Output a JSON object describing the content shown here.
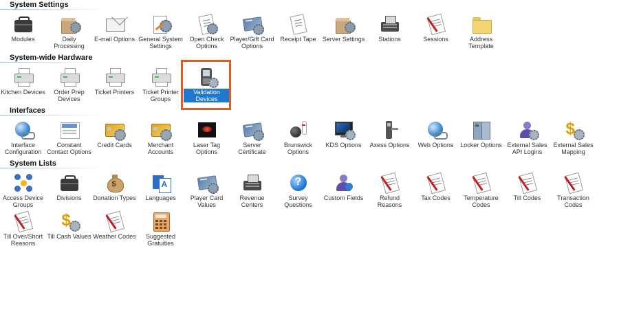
{
  "colors": {
    "selection_border": "#e55a20",
    "selection_bg": "#1e78d0",
    "header_rule": "#8ab4d6"
  },
  "sections": [
    {
      "title": "System Settings",
      "items": [
        {
          "label": "Modules",
          "icon": "briefcase-icon"
        },
        {
          "label": "Daily Processing",
          "icon": "gear-box-icon"
        },
        {
          "label": "E-mail Options",
          "icon": "envelope-icon"
        },
        {
          "label": "General System Settings",
          "icon": "gear-sheet-icon"
        },
        {
          "label": "Open Check Options",
          "icon": "check-gear-icon"
        },
        {
          "label": "Player/Gift Card Options",
          "icon": "gift-card-icon"
        },
        {
          "label": "Receipt Tape",
          "icon": "receipt-icon"
        },
        {
          "label": "Server Settings",
          "icon": "server-box-icon"
        },
        {
          "label": "Stations",
          "icon": "register-icon"
        },
        {
          "label": "Sessions",
          "icon": "checklist-icon"
        },
        {
          "label": "Address Template",
          "icon": "folder-icon"
        }
      ]
    },
    {
      "title": "System-wide Hardware",
      "items": [
        {
          "label": "Kitchen Devices",
          "icon": "printer-icon"
        },
        {
          "label": "Order Prep Devices",
          "icon": "printer-icon"
        },
        {
          "label": "Ticket Printers",
          "icon": "printer-icon"
        },
        {
          "label": "Ticket Printer Groups",
          "icon": "printer-icon"
        },
        {
          "label": "Validation Devices",
          "icon": "handheld-device-icon",
          "selected": true
        }
      ]
    },
    {
      "title": "Interfaces",
      "items": [
        {
          "label": "Interface Configuration",
          "icon": "globe-link-icon"
        },
        {
          "label": "Constant Contact Options",
          "icon": "constant-contact-icon"
        },
        {
          "label": "Credit Cards",
          "icon": "credit-card-icon"
        },
        {
          "label": "Merchant Accounts",
          "icon": "credit-card-icon"
        },
        {
          "label": "Laser Tag Options",
          "icon": "laser-tag-icon"
        },
        {
          "label": "Server Certificate",
          "icon": "certificate-card-icon"
        },
        {
          "label": "Brunswick Options",
          "icon": "bowling-icon"
        },
        {
          "label": "KDS Options",
          "icon": "monitor-icon"
        },
        {
          "label": "Axess Options",
          "icon": "turnstile-icon"
        },
        {
          "label": "Web Options",
          "icon": "globe-link-icon"
        },
        {
          "label": "Locker Options",
          "icon": "locker-icon"
        },
        {
          "label": "External Sales API Logins",
          "icon": "user-icon"
        },
        {
          "label": "External Sales Mapping",
          "icon": "dollar-gear-icon"
        }
      ]
    },
    {
      "title": "System Lists",
      "items": [
        {
          "label": "Access Device Groups",
          "icon": "network-icon"
        },
        {
          "label": "Divisions",
          "icon": "briefcase-icon"
        },
        {
          "label": "Donation Types",
          "icon": "money-bag-icon"
        },
        {
          "label": "Languages",
          "icon": "languages-icon"
        },
        {
          "label": "Player Card Values",
          "icon": "gift-card-icon"
        },
        {
          "label": "Revenue Centers",
          "icon": "register-icon"
        },
        {
          "label": "Survey Questions",
          "icon": "help-icon"
        },
        {
          "label": "Custom Fields",
          "icon": "user-help-icon"
        },
        {
          "label": "Refund Reasons",
          "icon": "checklist-icon"
        },
        {
          "label": "Tax Codes",
          "icon": "checklist-icon"
        },
        {
          "label": "Temperature Codes",
          "icon": "checklist-icon"
        },
        {
          "label": "Till Codes",
          "icon": "checklist-icon"
        },
        {
          "label": "Transaction Codes",
          "icon": "checklist-icon"
        },
        {
          "label": "Till Over/Short Reasons",
          "icon": "checklist-icon"
        },
        {
          "label": "Till Cash Values",
          "icon": "dollar-gear-icon"
        },
        {
          "label": "Weather Codes",
          "icon": "checklist-icon"
        },
        {
          "label": "Suggested Gratuities",
          "icon": "calculator-icon"
        }
      ]
    }
  ]
}
